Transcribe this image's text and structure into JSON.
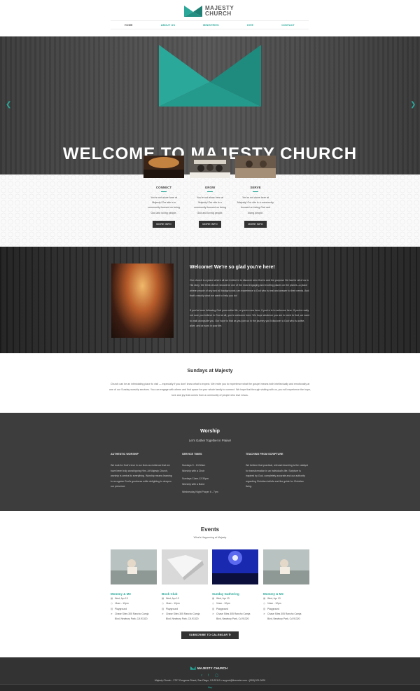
{
  "brand": {
    "name_line1": "MAJESTY",
    "name_line2": "CHURCH",
    "footer_name": "MAJESTY CHURCH",
    "accent_color": "#2aa89a",
    "dark_color": "#333333"
  },
  "nav": {
    "items": [
      {
        "label": "HOME"
      },
      {
        "label": "ABOUT US"
      },
      {
        "label": "MINISTRIES"
      },
      {
        "label": "GIVE"
      },
      {
        "label": "CONTACT"
      }
    ]
  },
  "hero": {
    "title": "WELCOME TO MAJESTY CHURCH",
    "prev_icon": "chevron-left-icon",
    "next_icon": "chevron-right-icon"
  },
  "cards": [
    {
      "title": "CONNECT",
      "line1": "You're not alone here at",
      "line2": "Majesty! Our site is a",
      "line3": "community focused on being",
      "line4": "God and loving people.",
      "button": "MORE INFO"
    },
    {
      "title": "GROW",
      "line1": "You're not alone here at",
      "line2": "Majesty! Our site is a",
      "line3": "community focused on being",
      "line4": "God and loving people.",
      "button": "MORE INFO"
    },
    {
      "title": "SERVE",
      "line1": "You're not alone here at",
      "line2": "Majesty! Our site is a community",
      "line3": "focused on being God and",
      "line4": "loving people.",
      "button": "MORE INFO"
    }
  ],
  "welcome": {
    "title": "Welcome! We're so glad you're here!",
    "para1": "Our church is a place where all are invited in to discover who God is and the purpose He has for all of us in His story. We think church should be one of the most engaging and exciting places on the planet—a place where people of any and all backgrounds can experience a God who is real and answer to their needs. And that's exactly what we want to help you do!",
    "para2": "If you've been following God your entire life, or you're new here, if you're in to welcome here. If you're really not sure you believe in God at all, you're welcome here. We hope whatever you are in need to find, we want to walk alongside you. Our hope is that as you join us in the journey you'll discover a God who is active, alive, and at work in your life."
  },
  "sundays": {
    "title": "Sundays at Majesty",
    "text": "Church can be an intimidating place to visit — especially if you don't know what to expect. We invite you to experience what the gospel means both intellectually and emotionally at one of our Sunday worship services. You can engage with others and find space for your whole family to connect. We hope that through visiting with us, you will experience the hope, love and joy that comes from a community of people who love Jesus."
  },
  "worship": {
    "title": "Worship",
    "subtitle": "Let's Gather Together in Praise!",
    "col1": {
      "heading": "AUTHENTIC WORSHIP",
      "text": "We look for God's love in our lives as evidence that we have been truly worshipping Him. At Majesty Church, worship is central to everything. Worship means learning to recognize God's goodness while delighting to deepen our presence."
    },
    "col2": {
      "heading": "SERVICE TIMES",
      "line1": "Sundays 9 - 10:30am",
      "line2": "Worship with a Choir",
      "line3": "Sundays 11am-12:30pm",
      "line4": "Worship with a Band",
      "line5": "Wednesday Night Prayer 6 - 7pm"
    },
    "col3": {
      "heading": "TEACHING FROM SCRIPTURE",
      "text": "We believe that practical, relevant teaching is the catalyst for transformation in an individual's life. Scripture is inspired by God, completely accurate and our authority regarding Christian beliefs and the guide for Christian living."
    }
  },
  "events": {
    "title": "Events",
    "subtitle": "What's Happening at Majesty",
    "items": [
      {
        "title": "Mommy & Me",
        "date": "Wed, Apr 13",
        "time": "11am - 12pm",
        "location": "Playground",
        "address1": "Chase Sites 305 Rancho Carnja",
        "address2": "Blvd, Newbury Park, CA 91320"
      },
      {
        "title": "Book Club",
        "date": "Wed, Apr 13",
        "time": "11am - 12pm",
        "location": "Playground",
        "address1": "Chase Sites 305 Rancho Carnja",
        "address2": "Blvd, Newbury Park, CA 91320"
      },
      {
        "title": "Sunday Gathering",
        "date": "Wed, Apr 13",
        "time": "11am - 12pm",
        "location": "Playground",
        "address1": "Chase Sites 305 Rancho Carnja",
        "address2": "Blvd, Newbury Park, CA 91320"
      },
      {
        "title": "Mommy & Me",
        "date": "Wed, Apr 13",
        "time": "11am - 12pm",
        "location": "Playground",
        "address1": "Chase Sites 305 Rancho Carnja",
        "address2": "Blvd, Newbury Park, CA 91320"
      }
    ],
    "subscribe": "SUBSCRIBE TO CALENDAR"
  },
  "footer": {
    "info": "Majesty Church - 2707 Congress Street, San Diego, CA 92110 • support@themeier.com • (905) 521-0000",
    "bottom_link": "Map"
  }
}
